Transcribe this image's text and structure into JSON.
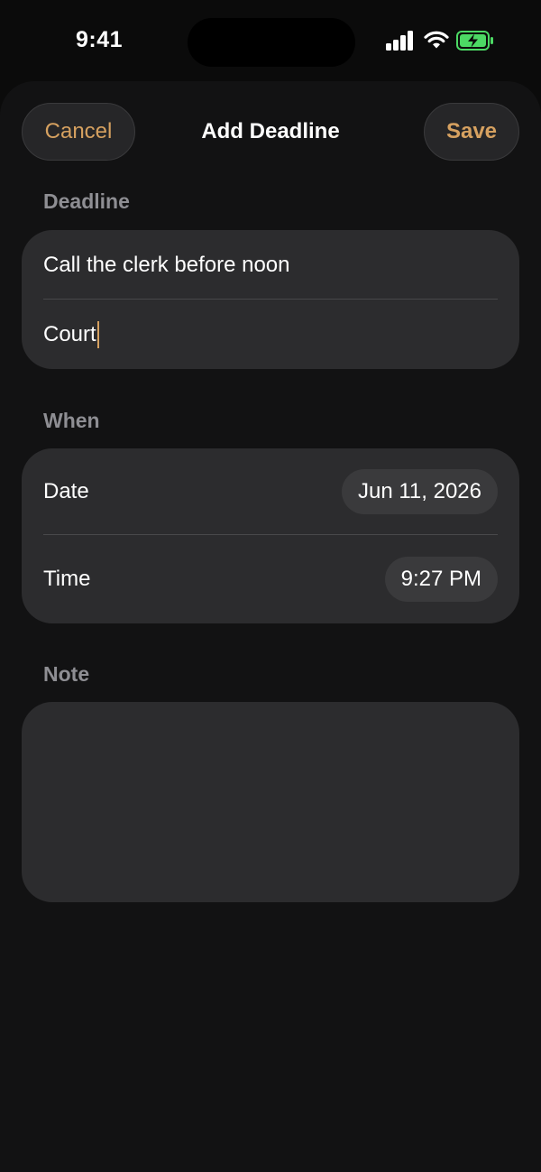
{
  "status": {
    "time": "9:41"
  },
  "nav": {
    "cancel_label": "Cancel",
    "title": "Add Deadline",
    "save_label": "Save"
  },
  "deadline_section": {
    "header": "Deadline",
    "title_value": "Call the clerk before noon",
    "category_value": "Court"
  },
  "when_section": {
    "header": "When",
    "date_label": "Date",
    "date_value": "Jun 11, 2026",
    "time_label": "Time",
    "time_value": "9:27 PM"
  },
  "note_section": {
    "header": "Note",
    "value": ""
  },
  "colors": {
    "accent": "#d6a160",
    "background": "#0b0b0b",
    "card": "#2c2c2e",
    "battery": "#4cd964"
  }
}
